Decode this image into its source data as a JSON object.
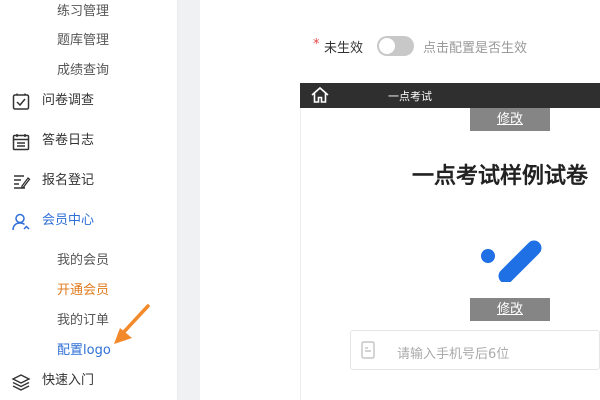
{
  "sidebar": {
    "sub_top": [
      "练习管理",
      "题库管理",
      "成绩查询"
    ],
    "nav": [
      {
        "label": "问卷调查",
        "icon": "survey-icon"
      },
      {
        "label": "答卷日志",
        "icon": "log-icon"
      },
      {
        "label": "报名登记",
        "icon": "registration-icon"
      },
      {
        "label": "会员中心",
        "icon": "member-icon"
      }
    ],
    "member_items": [
      "我的会员",
      "开通会员",
      "我的订单",
      "配置logo"
    ],
    "quick_start": {
      "label": "快速入门",
      "icon": "layers-icon"
    }
  },
  "settings": {
    "required_mark": "*",
    "toggle_label": "未生效",
    "toggle_on": false,
    "toggle_hint": "点击配置是否生效"
  },
  "preview": {
    "top_title": "一点考试",
    "edit_label_1": "修改",
    "exam_title": "一点考试样例试卷",
    "edit_label_2": "修改",
    "phone_placeholder": "请输入手机号后6位"
  },
  "colors": {
    "accent": "#2f6fd6",
    "orange": "#e07b1f",
    "toggle_off": "#c8c8c8",
    "preview_bar": "#2f2f2f",
    "edit_button": "#858585",
    "logo_blue": "#1f6fe5"
  }
}
